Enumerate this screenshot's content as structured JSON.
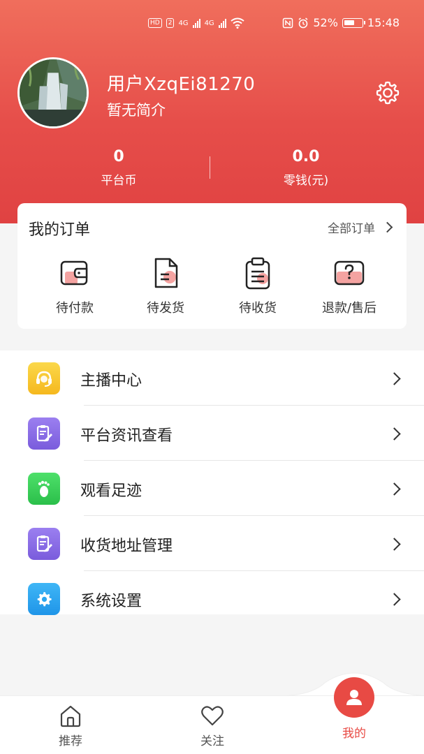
{
  "status_bar": {
    "left_badges": [
      "HD",
      "2",
      "4G",
      "4G"
    ],
    "battery": "52%",
    "time": "15:48"
  },
  "profile": {
    "username": "用户XzqEi81270",
    "bio": "暂无简介",
    "settings_icon": "gear-icon"
  },
  "stats": [
    {
      "value": "0",
      "label": "平台币"
    },
    {
      "value": "0.0",
      "label": "零钱(元)"
    }
  ],
  "orders": {
    "title": "我的订单",
    "all_label": "全部订单",
    "items": [
      {
        "label": "待付款",
        "icon": "wallet-icon"
      },
      {
        "label": "待发货",
        "icon": "document-icon"
      },
      {
        "label": "待收货",
        "icon": "clipboard-icon"
      },
      {
        "label": "退款/售后",
        "icon": "question-box-icon"
      }
    ]
  },
  "menu": [
    {
      "label": "主播中心",
      "icon": "headset-icon",
      "color": "#f7c531"
    },
    {
      "label": "平台资讯查看",
      "icon": "edit-note-icon",
      "color": "#8b6ee6"
    },
    {
      "label": "观看足迹",
      "icon": "footprint-icon",
      "color": "#3dcc5a"
    },
    {
      "label": "收货地址管理",
      "icon": "edit-note-icon",
      "color": "#8b6ee6"
    },
    {
      "label": "系统设置",
      "icon": "gear-icon",
      "color": "#2aa6f0"
    }
  ],
  "tabbar": {
    "tabs": [
      {
        "label": "推荐",
        "icon": "home-icon"
      },
      {
        "label": "关注",
        "icon": "heart-icon"
      },
      {
        "label": "我的",
        "icon": "user-icon",
        "active": true
      }
    ],
    "accent": "#e84a44"
  }
}
